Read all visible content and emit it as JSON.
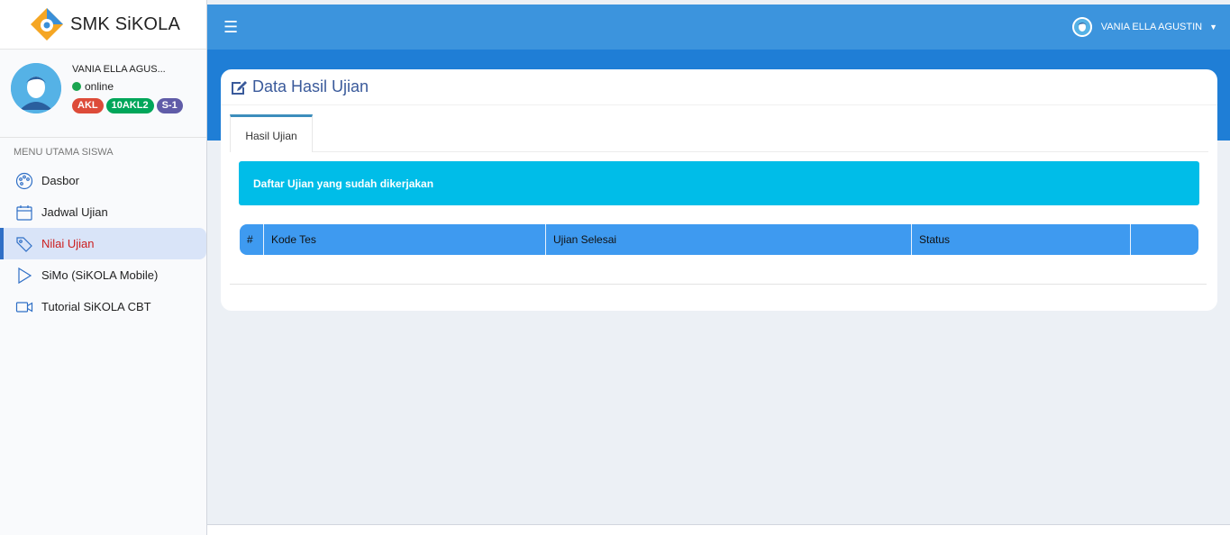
{
  "brand": {
    "name": "SMK SiKOLA"
  },
  "user": {
    "name_short": "VANIA ELLA AGUS...",
    "status": "online",
    "badges": [
      "AKL",
      "10AKL2",
      "S-1"
    ]
  },
  "sidebar": {
    "header": "MENU UTAMA SISWA",
    "items": [
      {
        "label": "Dasbor",
        "icon": "palette-icon"
      },
      {
        "label": "Jadwal Ujian",
        "icon": "calendar-icon"
      },
      {
        "label": "Nilai Ujian",
        "icon": "tags-icon",
        "active": true
      },
      {
        "label": "SiMo (SiKOLA Mobile)",
        "icon": "play-icon"
      },
      {
        "label": "Tutorial SiKOLA CBT",
        "icon": "video-icon"
      }
    ]
  },
  "topbar": {
    "menu_icon": "hamburger-icon",
    "user_name": "VANIA ELLA AGUSTIN"
  },
  "card": {
    "title": "Data Hasil Ujian",
    "tab": "Hasil Ujian",
    "callout": "Daftar Ujian yang sudah dikerjakan",
    "table": {
      "columns": [
        "#",
        "Kode Tes",
        "Ujian Selesai",
        "Status",
        ""
      ]
    }
  },
  "colors": {
    "topbar": "#3c94dd",
    "band": "#1f7ed6",
    "callout": "#00bde8",
    "table_head": "#3e9af0",
    "active_item": "#cc1f1f"
  }
}
